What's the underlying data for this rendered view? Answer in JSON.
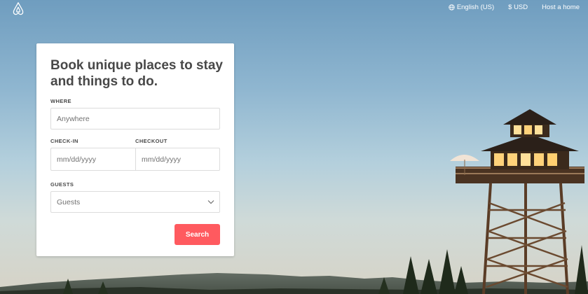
{
  "nav": {
    "language": "English (US)",
    "currency": "$ USD",
    "host": "Host a home"
  },
  "search_card": {
    "title": "Book unique places to stay and things to do.",
    "where_label": "WHERE",
    "where_placeholder": "Anywhere",
    "checkin_label": "CHECK-IN",
    "checkout_label": "CHECKOUT",
    "checkin_placeholder": "mm/dd/yyyy",
    "checkout_placeholder": "mm/dd/yyyy",
    "guests_label": "GUESTS",
    "guests_value": "Guests",
    "search_label": "Search"
  },
  "colors": {
    "accent": "#ff5a5f",
    "text": "#484848"
  }
}
